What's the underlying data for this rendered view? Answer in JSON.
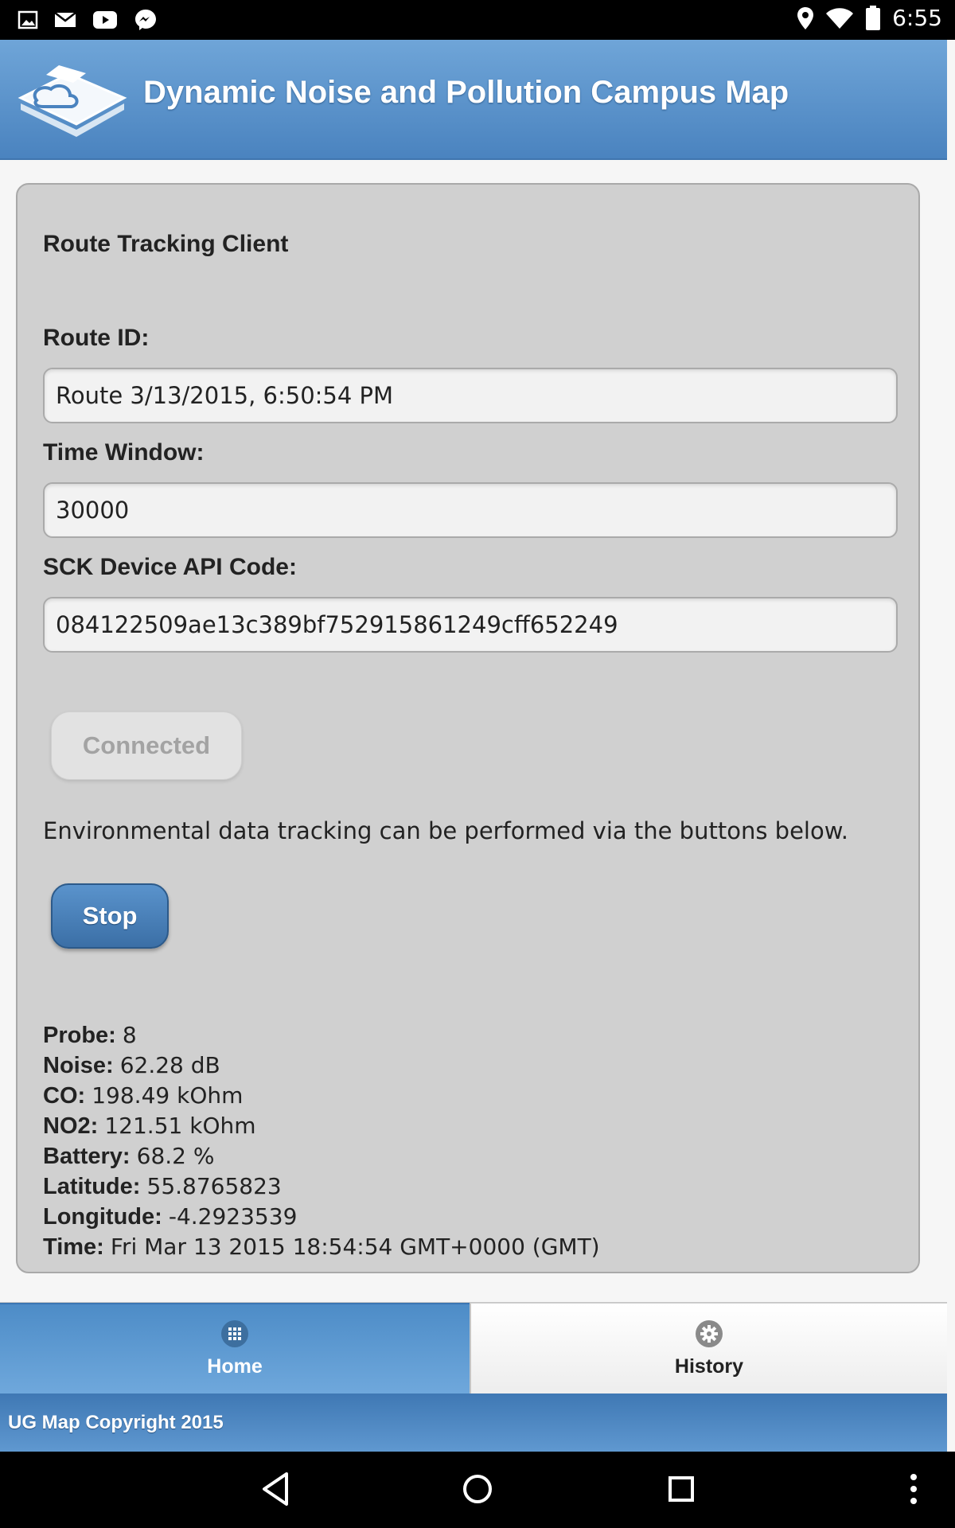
{
  "status_bar": {
    "time": "6:55",
    "left_icons": [
      "image-icon",
      "mail-icon",
      "youtube-icon",
      "messenger-icon"
    ],
    "right_icons": [
      "location-icon",
      "wifi-icon",
      "battery-icon"
    ]
  },
  "header": {
    "title": "Dynamic Noise and Pollution Campus Map",
    "logo_icon": "cloud-sensor-logo-icon"
  },
  "card": {
    "title": "Route Tracking Client",
    "route_id": {
      "label": "Route ID:",
      "value": "Route 3/13/2015, 6:50:54 PM"
    },
    "time_window": {
      "label": "Time Window:",
      "value": "30000"
    },
    "api_code": {
      "label": "SCK Device API Code:",
      "value": "084122509ae13c389bf752915861249cff652249"
    },
    "connected_label": "Connected",
    "info_text": "Environmental data tracking can be performed via the buttons below.",
    "stop_label": "Stop",
    "readings": [
      {
        "key": "Probe:",
        "value": "8"
      },
      {
        "key": "Noise:",
        "value": "62.28 dB"
      },
      {
        "key": "CO:",
        "value": "198.49 kOhm"
      },
      {
        "key": "NO2:",
        "value": "121.51 kOhm"
      },
      {
        "key": "Battery:",
        "value": "68.2 %"
      },
      {
        "key": "Latitude:",
        "value": "55.8765823"
      },
      {
        "key": "Longitude:",
        "value": "-4.2923539"
      },
      {
        "key": "Time:",
        "value": "Fri Mar 13 2015 18:54:54 GMT+0000 (GMT)"
      }
    ]
  },
  "navbar": {
    "home": {
      "label": "Home",
      "icon": "grid-icon",
      "active": true
    },
    "history": {
      "label": "History",
      "icon": "gear-icon",
      "active": false
    }
  },
  "footer": {
    "text": "UG Map Copyright 2015"
  },
  "colors": {
    "header_accent": "#5b94cc",
    "button_primary": "#3f74ab",
    "card_bg": "#d0d0d0"
  }
}
